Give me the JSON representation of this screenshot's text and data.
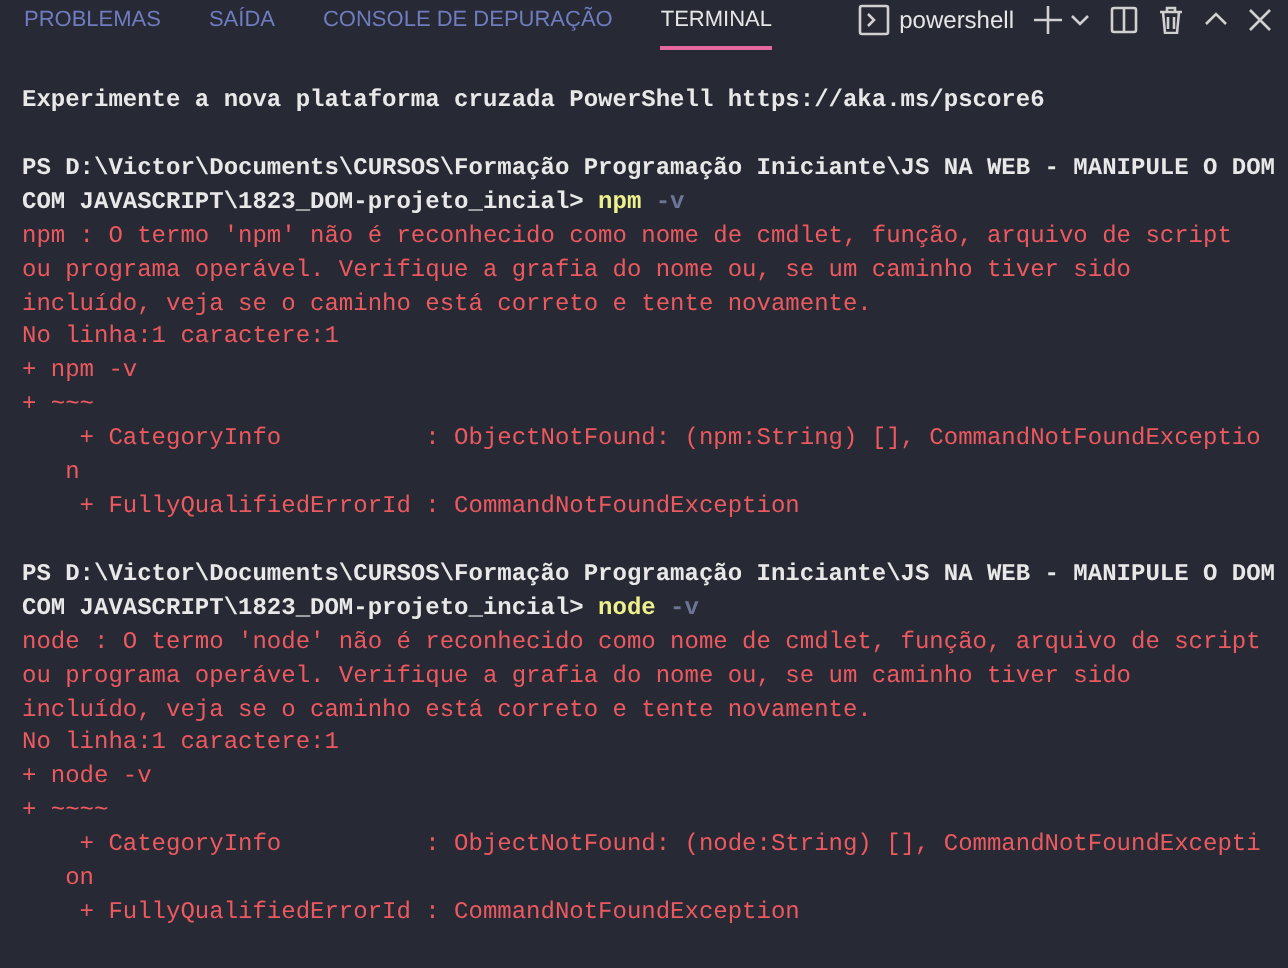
{
  "tabs": [
    {
      "label": "PROBLEMAS",
      "selected": false
    },
    {
      "label": "SAÍDA",
      "selected": false
    },
    {
      "label": "CONSOLE DE DEPURAÇÃO",
      "selected": false
    },
    {
      "label": "TERMINAL",
      "selected": true
    }
  ],
  "terminal_selector": {
    "label": "powershell"
  },
  "output": [
    [
      [
        {
          "kind": "plain",
          "text": "Experimente a nova plataforma cruzada PowerShell https://aka.ms/pscore6"
        }
      ]
    ],
    [
      [
        {
          "kind": "plain",
          "text": "PS D:\\Victor\\Documents\\CURSOS\\Formação Programação Iniciante\\JS NA WEB - MANIPULE O DOM"
        }
      ],
      [
        {
          "kind": "plain",
          "text": "COM JAVASCRIPT\\1823_DOM-projeto_incial> "
        },
        {
          "kind": "command",
          "text": "npm"
        },
        {
          "kind": "flag",
          "text": " -v"
        }
      ],
      [
        {
          "kind": "error",
          "text": "npm : O termo 'npm' não é reconhecido como nome de cmdlet, função, arquivo de script"
        }
      ],
      [
        {
          "kind": "error",
          "text": "ou programa operável. Verifique a grafia do nome ou, se um caminho tiver sido"
        }
      ],
      [
        {
          "kind": "error",
          "text": "incluído, veja se o caminho está correto e tente novamente."
        }
      ],
      [
        {
          "kind": "error",
          "text": "No linha:1 caractere:1"
        }
      ],
      [
        {
          "kind": "error",
          "text": "+ npm -v"
        }
      ],
      [
        {
          "kind": "error",
          "text": "+ ~~~"
        }
      ],
      [
        {
          "kind": "error",
          "text": "    + CategoryInfo          : ObjectNotFound: (npm:String) [], CommandNotFoundExceptio"
        }
      ],
      [
        {
          "kind": "error",
          "text": "   n"
        }
      ],
      [
        {
          "kind": "error",
          "text": "    + FullyQualifiedErrorId : CommandNotFoundException"
        }
      ]
    ],
    [
      [
        {
          "kind": "plain",
          "text": "PS D:\\Victor\\Documents\\CURSOS\\Formação Programação Iniciante\\JS NA WEB - MANIPULE O DOM"
        }
      ],
      [
        {
          "kind": "plain",
          "text": "COM JAVASCRIPT\\1823_DOM-projeto_incial> "
        },
        {
          "kind": "command",
          "text": "node"
        },
        {
          "kind": "flag",
          "text": " -v"
        }
      ],
      [
        {
          "kind": "error",
          "text": "node : O termo 'node' não é reconhecido como nome de cmdlet, função, arquivo de script"
        }
      ],
      [
        {
          "kind": "error",
          "text": "ou programa operável. Verifique a grafia do nome ou, se um caminho tiver sido"
        }
      ],
      [
        {
          "kind": "error",
          "text": "incluído, veja se o caminho está correto e tente novamente."
        }
      ],
      [
        {
          "kind": "error",
          "text": "No linha:1 caractere:1"
        }
      ],
      [
        {
          "kind": "error",
          "text": "+ node -v"
        }
      ],
      [
        {
          "kind": "error",
          "text": "+ ~~~~"
        }
      ],
      [
        {
          "kind": "error",
          "text": "    + CategoryInfo          : ObjectNotFound: (node:String) [], CommandNotFoundExcepti"
        }
      ],
      [
        {
          "kind": "error",
          "text": "   on"
        }
      ],
      [
        {
          "kind": "error",
          "text": "    + FullyQualifiedErrorId : CommandNotFoundException"
        }
      ]
    ]
  ]
}
